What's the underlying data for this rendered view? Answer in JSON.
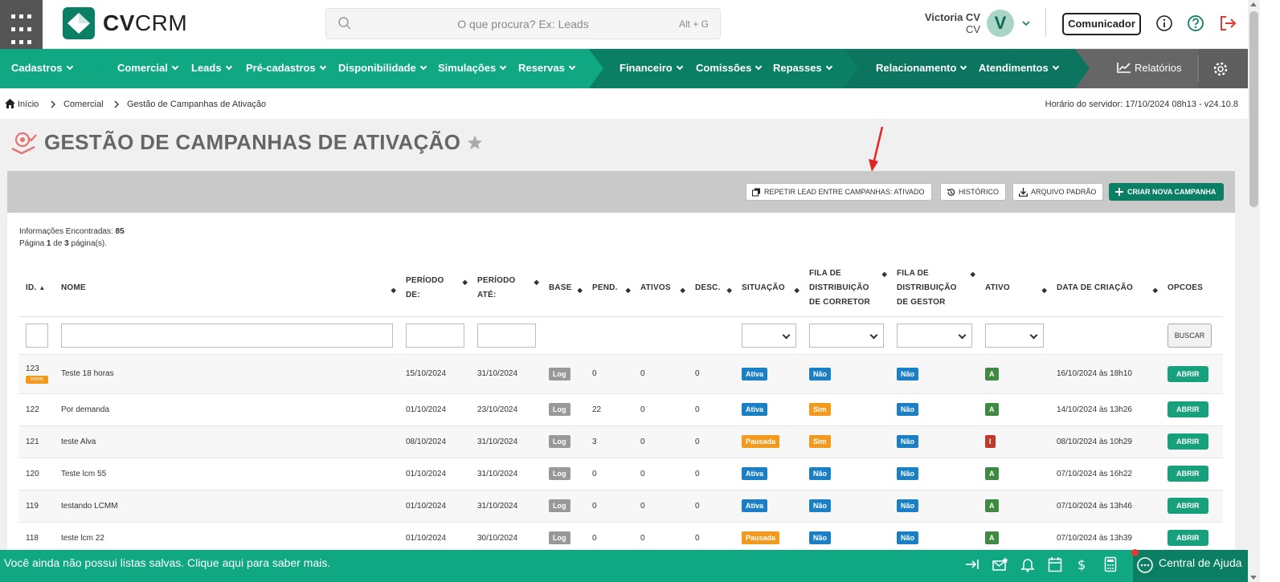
{
  "app": {
    "brand_bold": "CV",
    "brand_light": "CRM"
  },
  "search": {
    "placeholder": "O que procura? Ex: Leads",
    "shortcut": "Alt + G"
  },
  "user": {
    "name": "Victoria CV",
    "sub": "CV",
    "avatar_letter": "V"
  },
  "header": {
    "communicator": "Comunicador"
  },
  "nav": [
    {
      "label": "Cadastros"
    },
    {
      "label": "Comercial"
    },
    {
      "label": "Leads"
    },
    {
      "label": "Pré-cadastros"
    },
    {
      "label": "Disponibilidade"
    },
    {
      "label": "Simulações"
    },
    {
      "label": "Reservas"
    },
    {
      "label": "Financeiro"
    },
    {
      "label": "Comissões"
    },
    {
      "label": "Repasses"
    },
    {
      "label": "Relacionamento"
    },
    {
      "label": "Atendimentos"
    },
    {
      "label": "Relatórios"
    }
  ],
  "breadcrumb": {
    "home": "Início",
    "level1": "Comercial",
    "current": "Gestão de Campanhas de Ativação",
    "server_time": "Horário do servidor: 17/10/2024 08h13 - v24.10.8"
  },
  "page": {
    "title": "GESTÃO DE CAMPANHAS DE ATIVAÇÃO"
  },
  "toolbar": {
    "repeat_lead": "REPETIR LEAD ENTRE CAMPANHAS: ATIVADO",
    "history": "HISTÓRICO",
    "default_file": "ARQUIVO PADRÃO",
    "create": "CRIAR NOVA CAMPANHA"
  },
  "info": {
    "found_label": "Informações Encontradas:",
    "found_count": "85",
    "page_prefix": "Página",
    "page_current": "1",
    "page_of": "de",
    "page_total": "3",
    "page_suffix": "página(s)."
  },
  "table": {
    "headers": {
      "id": "ID.",
      "name": "NOME",
      "from_1": "PERÍODO",
      "from_2": "DE:",
      "to_1": "PERÍODO",
      "to_2": "ATÉ:",
      "base": "BASE",
      "pend": "PEND.",
      "active_count": "ATIVOS",
      "desc": "DESC.",
      "situation": "SITUAÇÃO",
      "fila_c_1": "FILA DE",
      "fila_c_2": "DISTRIBUIÇÃO",
      "fila_c_3": "DE CORRETOR",
      "fila_g_1": "FILA DE",
      "fila_g_2": "DISTRIBUIÇÃO",
      "fila_g_3": "DE GESTOR",
      "active": "ATIVO",
      "created": "DATA DE CRIAÇÃO",
      "options": "OPCOES"
    },
    "search_button": "BUSCAR",
    "new_badge": "novo",
    "open_button": "ABRIR",
    "rows": [
      {
        "id": "123",
        "name": "Teste 18 horas",
        "from": "15/10/2024",
        "to": "31/10/2024",
        "base": "Log",
        "pend": "0",
        "ativos": "0",
        "desc": "0",
        "situacao": "Ativa",
        "fila_c": "Não",
        "fila_g": "Não",
        "ativo": "A",
        "created": "16/10/2024 às 18h10"
      },
      {
        "id": "122",
        "name": "Por demanda",
        "from": "01/10/2024",
        "to": "23/10/2024",
        "base": "Log",
        "pend": "22",
        "ativos": "0",
        "desc": "0",
        "situacao": "Ativa",
        "fila_c": "Sim",
        "fila_g": "Não",
        "ativo": "A",
        "created": "14/10/2024 às 13h26"
      },
      {
        "id": "121",
        "name": "teste Alva",
        "from": "08/10/2024",
        "to": "31/10/2024",
        "base": "Log",
        "pend": "3",
        "ativos": "0",
        "desc": "0",
        "situacao": "Pausada",
        "fila_c": "Sim",
        "fila_g": "Não",
        "ativo": "I",
        "created": "08/10/2024 às 10h29"
      },
      {
        "id": "120",
        "name": "Teste lcm 55",
        "from": "01/10/2024",
        "to": "31/10/2024",
        "base": "Log",
        "pend": "0",
        "ativos": "0",
        "desc": "0",
        "situacao": "Ativa",
        "fila_c": "Não",
        "fila_g": "Não",
        "ativo": "A",
        "created": "07/10/2024 às 16h22"
      },
      {
        "id": "119",
        "name": "testando LCMM",
        "from": "01/10/2024",
        "to": "31/10/2024",
        "base": "Log",
        "pend": "0",
        "ativos": "0",
        "desc": "0",
        "situacao": "Ativa",
        "fila_c": "Não",
        "fila_g": "Não",
        "ativo": "A",
        "created": "07/10/2024 às 13h46"
      },
      {
        "id": "118",
        "name": "teste lcm 22",
        "from": "01/10/2024",
        "to": "30/10/2024",
        "base": "Log",
        "pend": "0",
        "ativos": "0",
        "desc": "0",
        "situacao": "Pausada",
        "fila_c": "Não",
        "fila_g": "Não",
        "ativo": "A",
        "created": "07/10/2024 às 13h39"
      }
    ]
  },
  "footer": {
    "message": "Você ainda não possui listas salvas. Clique aqui para saber mais.",
    "help": "Central de Ajuda"
  },
  "colors": {
    "brand_green": "#0b7f63",
    "footer_green": "#0fa882",
    "red_icon": "#e53935",
    "status_blue": "#1a7fc4",
    "status_orange": "#f39a1e"
  }
}
